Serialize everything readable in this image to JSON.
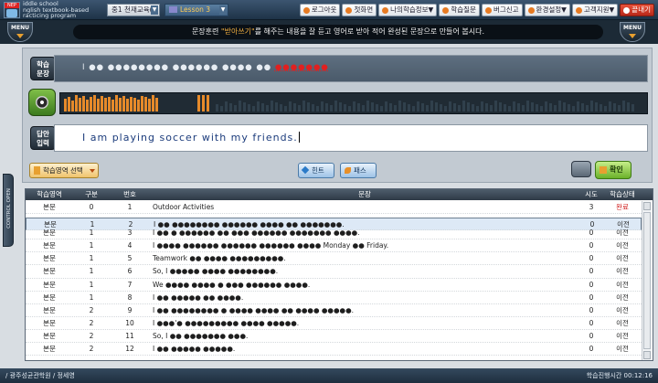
{
  "app": {
    "logo_text": "NEP",
    "title_lines": "iddle school\nnglish textbook-based\nracticing program"
  },
  "header": {
    "book_select": "중1 천재교육(",
    "lesson_select": "Lesson 3",
    "buttons": [
      {
        "label": "로그아웃"
      },
      {
        "label": "첫화면"
      },
      {
        "label": "나의학습정보▼"
      },
      {
        "label": "학습질문"
      },
      {
        "label": "버그신고"
      },
      {
        "label": "환경설정▼"
      },
      {
        "label": "고객지원▼"
      },
      {
        "label": "끝내기"
      }
    ]
  },
  "notice": {
    "menu_left": "MENU",
    "menu_right": "MENU",
    "prefix": "문장훈련 ",
    "highlight": "\"받아쓰기\"",
    "rest": "를 해주는 내용을 잘 듣고 영어로 받아 적어 완성된 문장으로 만들어 봅시다."
  },
  "side_tab": {
    "label": "CONTROL OPEN"
  },
  "study": {
    "study_label": "학습\n문장",
    "masked_sentence": "I ●● ●●●●●●●● ●●●●●● ●●●● ●●",
    "masked_tail": "●●●●●●●",
    "answer_label": "답안\n입력",
    "answer_text": "I am playing soccer with my friends."
  },
  "toolbar": {
    "area_select": "학습영역 선택",
    "hint": "힌트",
    "pass": "패스",
    "confirm": "확인"
  },
  "table": {
    "headers": [
      "학습영역",
      "구분",
      "번호",
      "문장",
      "시도",
      "학습상태"
    ],
    "rows": [
      {
        "area": "본문",
        "div": "0",
        "no": "1",
        "sentence": "Outdoor Activities",
        "tries": "3",
        "status": "완료"
      },
      {
        "area": "본문",
        "div": "1",
        "no": "2",
        "sentence": "I ●● ●●●●●●●● ●●●●●● ●●●● ●● ●●●●●●●.",
        "tries": "0",
        "status": "이전"
      },
      {
        "area": "본문",
        "div": "1",
        "no": "3",
        "sentence": "I ●● ● ●●●●●● ●● ●●● ●●●●●● ●●●●●●● ●●●●.",
        "tries": "0",
        "status": "이전"
      },
      {
        "area": "본문",
        "div": "1",
        "no": "4",
        "sentence": "I ●●●● ●●●●●● ●●●●●● ●●●●●● ●●●● Monday ●● Friday.",
        "tries": "0",
        "status": "이전"
      },
      {
        "area": "본문",
        "div": "1",
        "no": "5",
        "sentence": "Teamwork ●● ●●●● ●●●●●●●●●.",
        "tries": "0",
        "status": "이전"
      },
      {
        "area": "본문",
        "div": "1",
        "no": "6",
        "sentence": "So, I ●●●●● ●●●● ●●●●●●●●.",
        "tries": "0",
        "status": "이전"
      },
      {
        "area": "본문",
        "div": "1",
        "no": "7",
        "sentence": "We ●●●● ●●●● ● ●●● ●●●●●● ●●●●.",
        "tries": "0",
        "status": "이전"
      },
      {
        "area": "본문",
        "div": "1",
        "no": "8",
        "sentence": "I ●● ●●●●● ●● ●●●●.",
        "tries": "0",
        "status": "이전"
      },
      {
        "area": "본문",
        "div": "2",
        "no": "9",
        "sentence": "I ●● ●●●●●●●● ● ●●●● ●●●● ●● ●●●● ●●●●●.",
        "tries": "0",
        "status": "이전"
      },
      {
        "area": "본문",
        "div": "2",
        "no": "10",
        "sentence": "I ●●●'● ●●●●●●●●● ●●●● ●●●●●.",
        "tries": "0",
        "status": "이전"
      },
      {
        "area": "본문",
        "div": "2",
        "no": "11",
        "sentence": "So, I ●● ●●●●●●● ●●●.",
        "tries": "0",
        "status": "이전"
      },
      {
        "area": "본문",
        "div": "2",
        "no": "12",
        "sentence": "I ●● ●●●●● ●●●●●.",
        "tries": "0",
        "status": "이전"
      }
    ]
  },
  "status": {
    "left": "/ 광주성균관학원 / 정세영",
    "right": "학습진행시간 00:12:16"
  },
  "colors": {
    "accent_orange": "#e68a2a",
    "done_red": "#d02020",
    "header_dark": "#2e3a46"
  }
}
